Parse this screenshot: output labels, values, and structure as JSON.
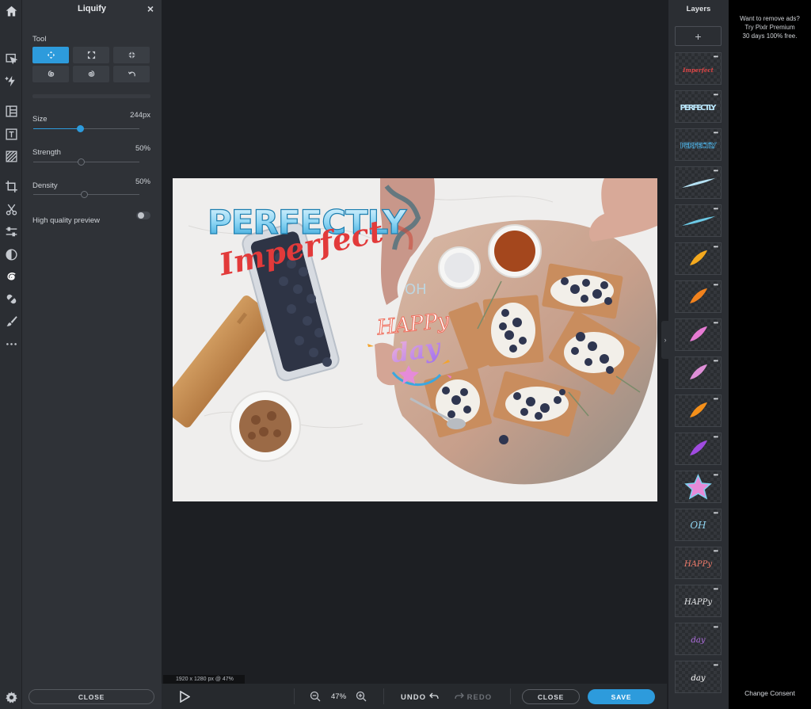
{
  "toolbar": {
    "items": [
      {
        "name": "home-icon"
      },
      {
        "name": "arrange-icon"
      },
      {
        "name": "ai-icon"
      },
      {
        "name": "layout-icon"
      },
      {
        "name": "text-icon"
      },
      {
        "name": "texture-icon"
      },
      {
        "name": "crop-icon"
      },
      {
        "name": "cutout-icon"
      },
      {
        "name": "adjust-icon"
      },
      {
        "name": "filter-icon"
      },
      {
        "name": "liquify-icon"
      },
      {
        "name": "heal-icon"
      },
      {
        "name": "brush-icon"
      },
      {
        "name": "more-icon"
      },
      {
        "name": "settings-icon"
      }
    ]
  },
  "panel": {
    "title": "Liquify",
    "close_x": "×",
    "tool_label": "Tool",
    "tools": [
      {
        "name": "push",
        "active": true
      },
      {
        "name": "bloat",
        "active": false
      },
      {
        "name": "pinch",
        "active": false
      },
      {
        "name": "swirl-left",
        "active": false
      },
      {
        "name": "swirl-right",
        "active": false
      },
      {
        "name": "restore",
        "active": false
      }
    ],
    "size": {
      "label": "Size",
      "value": "244px",
      "fraction": 0.44
    },
    "strength": {
      "label": "Strength",
      "value": "50%",
      "fraction": 0.45
    },
    "density": {
      "label": "Density",
      "value": "50%",
      "fraction": 0.48
    },
    "hq_preview": {
      "label": "High quality preview",
      "on": false
    },
    "close_label": "CLOSE"
  },
  "canvas": {
    "dimensions": "1920 x 1280 px @ 47%",
    "texts": {
      "perfectly": "PERFECTLY",
      "imperfect": "Imperfect",
      "oh": "OH",
      "happy": "HAPPy",
      "day": "day"
    }
  },
  "bottombar": {
    "zoom": "47%",
    "undo": "UNDO",
    "redo": "REDO",
    "close": "CLOSE",
    "save": "SAVE"
  },
  "layers": {
    "title": "Layers",
    "add": "+",
    "more": "•••",
    "items": [
      {
        "kind": "script",
        "text": "Imperfect",
        "color": "#e04646"
      },
      {
        "kind": "block",
        "text": "PERFECTLY",
        "color": "#b9e6fb"
      },
      {
        "kind": "outline",
        "text": "PERFECTLY",
        "color": "#4fb4e8"
      },
      {
        "kind": "stroke",
        "color": "#b5e1f3"
      },
      {
        "kind": "stroke",
        "color": "#6cc9e6"
      },
      {
        "kind": "leaf",
        "color": "#f4a91e"
      },
      {
        "kind": "leaf",
        "color": "#f2821d"
      },
      {
        "kind": "leaf",
        "color": "#e67ad3"
      },
      {
        "kind": "leaf",
        "color": "#df8fd8"
      },
      {
        "kind": "leaf",
        "color": "#f5901a"
      },
      {
        "kind": "leaf",
        "color": "#a04be0"
      },
      {
        "kind": "star",
        "color": "#e68ad8"
      },
      {
        "kind": "word",
        "text": "OH",
        "color": "#8fd3ef"
      },
      {
        "kind": "word",
        "text": "HAPPy",
        "color": "#f07b6a"
      },
      {
        "kind": "word",
        "text": "HAPPy",
        "color": "#e6e8ea"
      },
      {
        "kind": "word",
        "text": "day",
        "color": "#b06ee0"
      },
      {
        "kind": "word",
        "text": "day",
        "color": "#ffffff"
      }
    ]
  },
  "ad": {
    "lines": [
      "Want to remove ads?",
      "Try Pixlr Premium",
      "30 days 100% free."
    ],
    "consent": "Change Consent"
  },
  "colors": {
    "accent": "#2d9bdc",
    "panel": "#2f3237",
    "background": "#1d1f23"
  }
}
